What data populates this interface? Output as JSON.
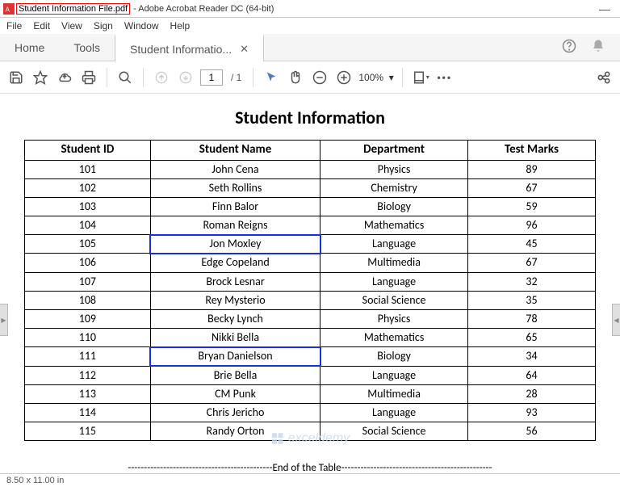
{
  "window": {
    "filename": "Student Information File.pdf",
    "app_title": "- Adobe Acrobat Reader DC (64-bit)"
  },
  "menu": [
    "File",
    "Edit",
    "View",
    "Sign",
    "Window",
    "Help"
  ],
  "tabs": {
    "home": "Home",
    "tools": "Tools",
    "doc": "Student Informatio..."
  },
  "toolbar": {
    "page_current": "1",
    "page_total": "/  1",
    "zoom": "100%"
  },
  "document": {
    "title": "Student Information",
    "headers": [
      "Student ID",
      "Student Name",
      "Department",
      "Test Marks"
    ],
    "rows": [
      [
        "101",
        "John Cena",
        "Physics",
        "89"
      ],
      [
        "102",
        "Seth Rollins",
        "Chemistry",
        "67"
      ],
      [
        "103",
        "Finn Balor",
        "Biology",
        "59"
      ],
      [
        "104",
        "Roman Reigns",
        "Mathematics",
        "96"
      ],
      [
        "105",
        "Jon Moxley",
        "Language",
        "45"
      ],
      [
        "106",
        "Edge Copeland",
        "Multimedia",
        "67"
      ],
      [
        "107",
        "Brock Lesnar",
        "Language",
        "32"
      ],
      [
        "108",
        "Rey Mysterio",
        "Social Science",
        "35"
      ],
      [
        "109",
        "Becky Lynch",
        "Physics",
        "78"
      ],
      [
        "110",
        "Nikki Bella",
        "Mathematics",
        "65"
      ],
      [
        "111",
        "Bryan Danielson",
        "Biology",
        "34"
      ],
      [
        "112",
        "Brie Bella",
        "Language",
        "64"
      ],
      [
        "113",
        "CM Punk",
        "Multimedia",
        "28"
      ],
      [
        "114",
        "Chris Jericho",
        "Language",
        "93"
      ],
      [
        "115",
        "Randy Orton",
        "Social Science",
        "56"
      ]
    ],
    "end_text": "---------------------------------------------End of the Table-----------------------------------------------"
  },
  "watermark": "exceldemy",
  "status": {
    "page_size": "8.50 x 11.00 in"
  },
  "highlight_rows": [
    4,
    10
  ]
}
